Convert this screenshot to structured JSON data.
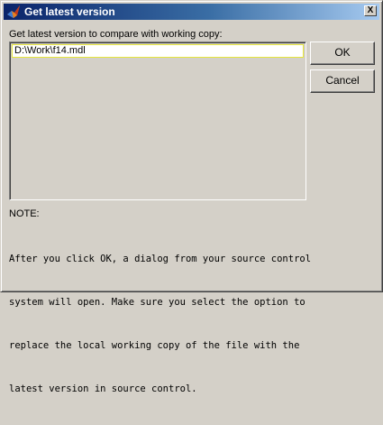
{
  "window": {
    "title": "Get latest version",
    "icon": "matlab-logo-icon",
    "close_label": "X"
  },
  "prompt": "Get latest version to compare with working copy:",
  "file_list": {
    "items": [
      "D:\\Work\\f14.mdl"
    ],
    "selected_index": 0
  },
  "buttons": {
    "ok": "OK",
    "cancel": "Cancel"
  },
  "note": {
    "heading": "NOTE:",
    "lines": [
      "After you click OK, a dialog from your source control",
      "system will open. Make sure you select the option to",
      "replace the local working copy of the file with the",
      "latest version in source control."
    ]
  },
  "colors": {
    "titlebar_start": "#0a246a",
    "titlebar_end": "#a6caf0",
    "dialog_bg": "#d4d0c8",
    "selection_border": "#e6e63c"
  }
}
